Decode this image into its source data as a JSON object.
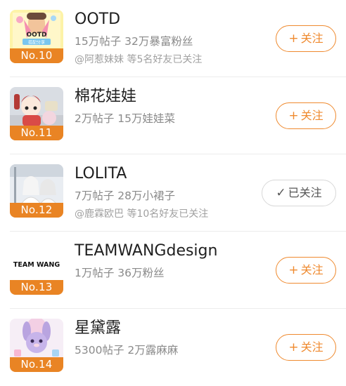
{
  "items": [
    {
      "title": "OOTD",
      "stats": "15万帖子 32万暴富粉丝",
      "friends": "@阿惹妹妹 等5名好友已关注",
      "rank": "No.10",
      "button_label": "关注",
      "button_glyph": "+",
      "followed": false,
      "thumb_text": "OOTD",
      "thumb_subtext": "搭配分享"
    },
    {
      "title": "棉花娃娃",
      "stats": "2万帖子 15万娃娃菜",
      "friends": "",
      "rank": "No.11",
      "button_label": "关注",
      "button_glyph": "+",
      "followed": false
    },
    {
      "title": "LOLITA",
      "stats": "7万帖子 28万小裙子",
      "friends": "@鹿霖欧巴 等10名好友已关注",
      "rank": "No.12",
      "button_label": "已关注",
      "button_glyph": "✓",
      "followed": true
    },
    {
      "title": "TEAMWANGdesign",
      "stats": "1万帖子 36万粉丝",
      "friends": "",
      "rank": "No.13",
      "button_label": "关注",
      "button_glyph": "+",
      "followed": false,
      "thumb_text": "TEAM WANG"
    },
    {
      "title": "星黛露",
      "stats": "5300帖子 2万露麻麻",
      "friends": "",
      "rank": "No.14",
      "button_label": "关注",
      "button_glyph": "+",
      "followed": false
    }
  ],
  "colors": {
    "accent": "#ef8a2f",
    "rank_badge": "#e98424"
  }
}
